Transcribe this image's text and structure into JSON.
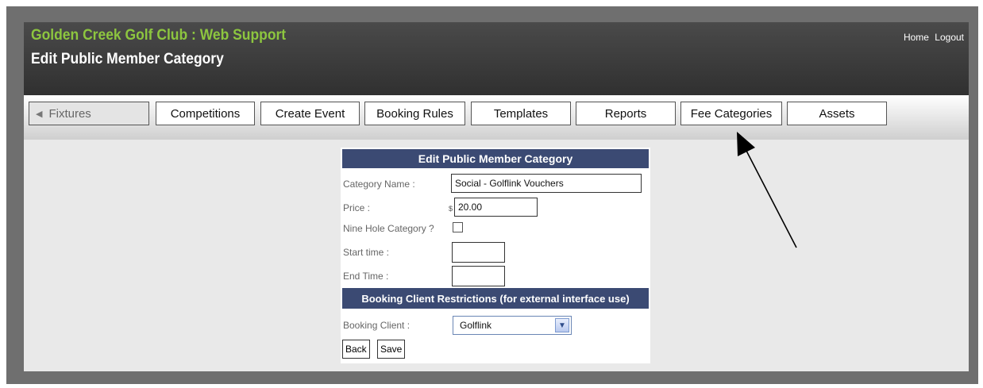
{
  "header": {
    "site_title": "Golden Creek Golf Club : Web Support",
    "page_title": "Edit Public Member Category",
    "links": [
      "Home",
      "Logout"
    ]
  },
  "nav": {
    "tabs": [
      "Fixtures",
      "Competitions",
      "Create Event",
      "Booking Rules",
      "Templates",
      "Reports",
      "Fee Categories",
      "Assets"
    ]
  },
  "form": {
    "title": "Edit Public Member Category",
    "category_name_label": "Category Name :",
    "category_name_value": "Social - Golflink Vouchers",
    "price_label": "Price :",
    "currency_symbol": "$",
    "price_value": "20.00",
    "nine_hole_label": "Nine Hole Category ?",
    "nine_hole_checked": false,
    "start_time_label": "Start time :",
    "start_time_value": "",
    "end_time_label": "End Time :",
    "end_time_value": "",
    "restrictions_title": "Booking Client Restrictions (for external interface use)",
    "booking_client_label": "Booking Client :",
    "booking_client_value": "Golflink",
    "back_label": "Back",
    "save_label": "Save"
  },
  "colors": {
    "header_bg": "#3a3a3a",
    "site_title": "#8dc63f",
    "panel_header": "#3b4a73"
  }
}
